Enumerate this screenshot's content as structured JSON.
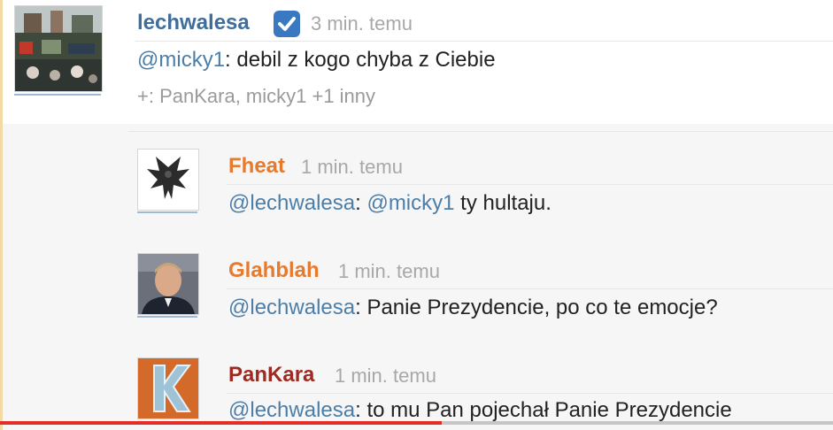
{
  "post": {
    "author": "lechwalesa",
    "time": "3 min. temu",
    "mention": "@micky1",
    "text": ": debil z kogo chyba z Ciebie",
    "plus": "+: PanKara, micky1 +1 inny"
  },
  "replies": [
    {
      "author": "Fheat",
      "time": "1 min. temu",
      "mention1": "@lechwalesa",
      "colon": ":",
      "mention2": "@micky1",
      "text": " ty hultaju."
    },
    {
      "author": "Glahblah",
      "time": "1 min. temu",
      "mention1": "@lechwalesa",
      "text": ": Panie Prezydencie, po co te emocje?"
    },
    {
      "author": "PanKara",
      "time": "1 min. temu",
      "mention1": "@lechwalesa",
      "text": ": to mu Pan pojechał Panie Prezydencie"
    }
  ],
  "colors": {
    "author_blue": "#3f6e9c",
    "author_orange": "#e67a2e",
    "author_red": "#9f2a22",
    "mention": "#4d7ea8",
    "progress": "#e52d27"
  },
  "video": {
    "progress_fraction": 0.53
  }
}
